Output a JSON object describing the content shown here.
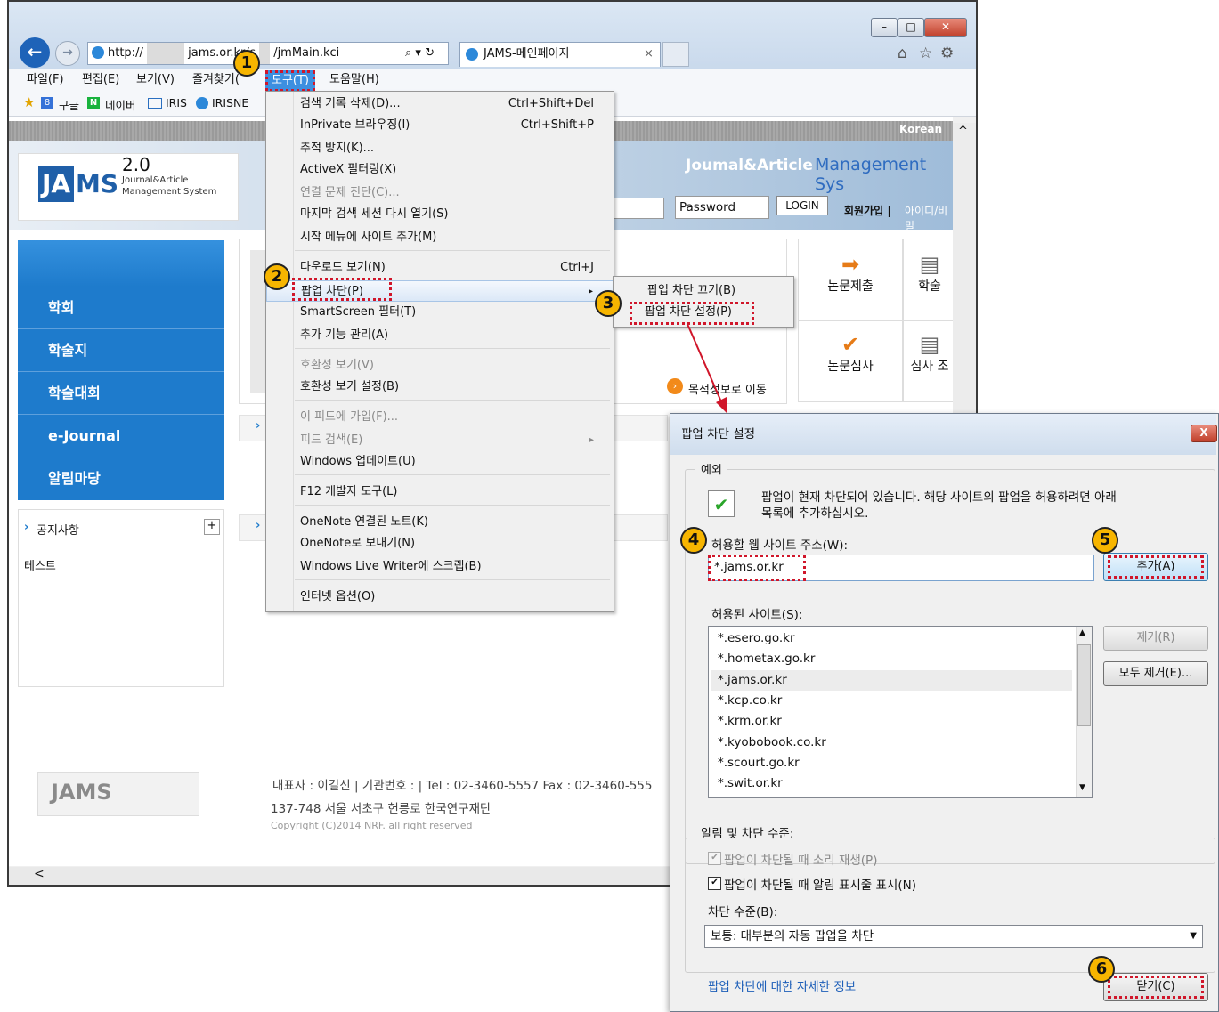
{
  "browser": {
    "url_prefix": "http://",
    "url_host": "jams.or.kr/c",
    "url_tail": "/jmMain.kci",
    "tab_title": "JAMS-메인페이지",
    "menu": [
      "파일(F)",
      "편집(E)",
      "보기(V)",
      "즐겨찾기(",
      "도구(T)",
      "도움말(H)"
    ],
    "favorites": [
      "구글",
      "네이버",
      "IRIS",
      "IRISNE"
    ]
  },
  "page": {
    "language": "Korean",
    "brand_tag": "Joumal&Article",
    "brand_text": "Management Sys",
    "logo_letters": "JAMS",
    "logo_version": "2.0",
    "logo_sub1": "Journal&Article",
    "logo_sub2": "Management System",
    "password_placeholder": "Password",
    "login_label": "LOGIN",
    "signup_label": "회원가입 |",
    "find_label": "아이디/비밀",
    "sidebar": [
      "학회",
      "학술지",
      "학술대회",
      "e-Journal",
      "알림마당"
    ],
    "notice_title": "공지사항",
    "notice_item": "테스트",
    "journal_link": "목적정보로 이동",
    "tiles": [
      "논문제출",
      "학술",
      "논문심사",
      "심사 조"
    ],
    "footer_line1": "대표자 : 이길신 | 기관번호 : | Tel : 02-3460-5557 Fax : 02-3460-555",
    "footer_line2": "137-748 서울 서초구 헌릉로 한국연구재단",
    "footer_line3": "Copyright (C)2014 NRF. all right reserved",
    "scroll_left_arrow": "<"
  },
  "tools_menu": {
    "items": [
      {
        "label": "검색 기록 삭제(D)...",
        "shortcut": "Ctrl+Shift+Del",
        "disabled": false
      },
      {
        "label": "InPrivate 브라우징(I)",
        "shortcut": "Ctrl+Shift+P",
        "disabled": false
      },
      {
        "label": "추적 방지(K)...",
        "shortcut": "",
        "disabled": false
      },
      {
        "label": "ActiveX 필터링(X)",
        "shortcut": "",
        "disabled": false
      },
      {
        "label": "연결 문제 진단(C)...",
        "shortcut": "",
        "disabled": true
      },
      {
        "label": "마지막 검색 세션 다시 열기(S)",
        "shortcut": "",
        "disabled": false
      },
      {
        "label": "시작 메뉴에 사이트 추가(M)",
        "shortcut": "",
        "disabled": false
      },
      {
        "label": "다운로드 보기(N)",
        "shortcut": "Ctrl+J",
        "disabled": false
      },
      {
        "label": "팝업 차단(P)",
        "shortcut": "",
        "disabled": false
      },
      {
        "label": "SmartScreen 필터(T)",
        "shortcut": "",
        "disabled": false
      },
      {
        "label": "추가 기능 관리(A)",
        "shortcut": "",
        "disabled": false
      },
      {
        "label": "호환성 보기(V)",
        "shortcut": "",
        "disabled": true
      },
      {
        "label": "호환성 보기 설정(B)",
        "shortcut": "",
        "disabled": false
      },
      {
        "label": "이 피드에 가입(F)...",
        "shortcut": "",
        "disabled": true
      },
      {
        "label": "피드 검색(E)",
        "shortcut": "",
        "disabled": true
      },
      {
        "label": "Windows 업데이트(U)",
        "shortcut": "",
        "disabled": false
      },
      {
        "label": "F12 개발자 도구(L)",
        "shortcut": "",
        "disabled": false
      },
      {
        "label": "OneNote 연결된 노트(K)",
        "shortcut": "",
        "disabled": false
      },
      {
        "label": "OneNote로 보내기(N)",
        "shortcut": "",
        "disabled": false
      },
      {
        "label": "Windows Live Writer에 스크랩(B)",
        "shortcut": "",
        "disabled": false
      },
      {
        "label": "인터넷 옵션(O)",
        "shortcut": "",
        "disabled": false
      }
    ],
    "submenu": [
      "팝업 차단 끄기(B)",
      "팝업 차단 설정(P)"
    ]
  },
  "dialog": {
    "title": "팝업 차단 설정",
    "close_glyph": "X",
    "exceptions_group": "예외",
    "info_text_1": "팝업이 현재 차단되어 있습니다. 해당 사이트의 팝업을 허용하려면 아래",
    "info_text_2": "목록에 추가하십시오.",
    "address_label": "허용할 웹 사이트 주소(W):",
    "address_value": "*.jams.or.kr",
    "add_button": "추가(A)",
    "allowed_label": "허용된 사이트(S):",
    "allowed_sites": [
      "*.esero.go.kr",
      "*.hometax.go.kr",
      "*.jams.or.kr",
      "*.kcp.co.kr",
      "*.krm.or.kr",
      "*.kyobobook.co.kr",
      "*.scourt.go.kr",
      "*.swit.or.kr"
    ],
    "remove_button": "제거(R)",
    "remove_all_button": "모두 제거(E)...",
    "notify_group": "알림 및 차단 수준:",
    "check_sound": "팝업이 차단될 때 소리 재생(P)",
    "check_bar": "팝업이 차단될 때 알림 표시줄 표시(N)",
    "level_label": "차단 수준(B):",
    "level_value": "보통: 대부분의 자동 팝업을 차단",
    "help_link": "팝업 차단에 대한 자세한 정보",
    "close_button": "닫기(C)"
  },
  "badges": [
    "1",
    "2",
    "3",
    "4",
    "5",
    "6"
  ]
}
